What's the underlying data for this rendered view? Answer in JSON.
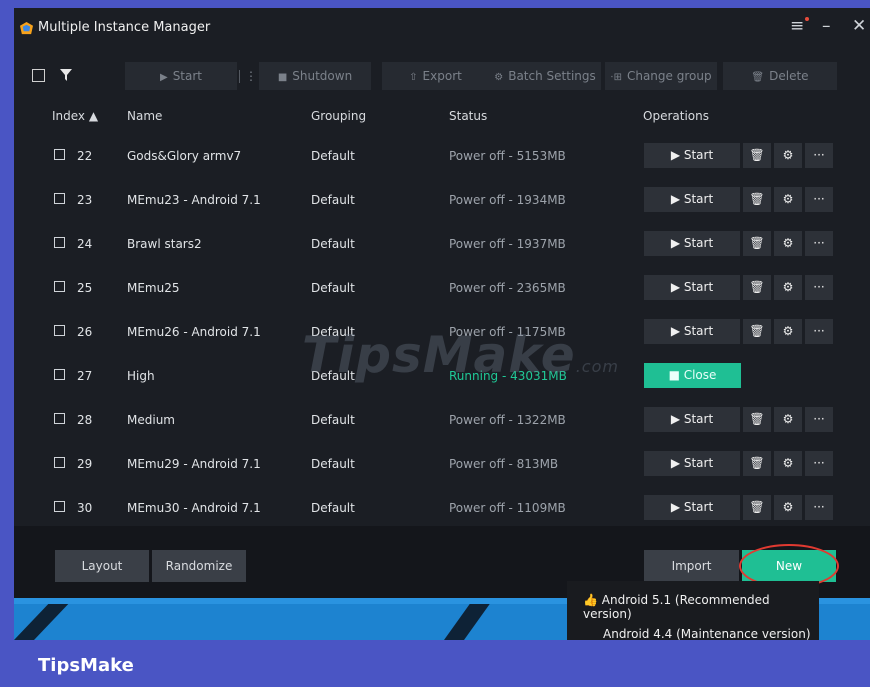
{
  "window": {
    "title": "Multiple Instance Manager",
    "menu_icon": "menu-icon",
    "minimize_icon": "minimize-icon",
    "close_icon": "close-icon"
  },
  "toolbar": {
    "start": "Start",
    "shutdown": "Shutdown",
    "export": "Export",
    "batch_settings": "Batch Settings",
    "change_group": "Change group",
    "delete": "Delete"
  },
  "table": {
    "headers": {
      "index": "Index ▲",
      "name": "Name",
      "grouping": "Grouping",
      "status": "Status",
      "operations": "Operations"
    },
    "rows": [
      {
        "index": "22",
        "name": "Gods&Glory armv7",
        "grouping": "Default",
        "status": "Power off - 5153MB",
        "action": "Start",
        "running": false
      },
      {
        "index": "23",
        "name": "MEmu23 - Android 7.1",
        "grouping": "Default",
        "status": "Power off - 1934MB",
        "action": "Start",
        "running": false
      },
      {
        "index": "24",
        "name": "Brawl stars2",
        "grouping": "Default",
        "status": "Power off - 1937MB",
        "action": "Start",
        "running": false
      },
      {
        "index": "25",
        "name": "MEmu25",
        "grouping": "Default",
        "status": "Power off - 2365MB",
        "action": "Start",
        "running": false
      },
      {
        "index": "26",
        "name": "MEmu26 - Android 7.1",
        "grouping": "Default",
        "status": "Power off - 1175MB",
        "action": "Start",
        "running": false
      },
      {
        "index": "27",
        "name": "High",
        "grouping": "Default",
        "status": "Running - 43031MB",
        "action": "Close",
        "running": true
      },
      {
        "index": "28",
        "name": "Medium",
        "grouping": "Default",
        "status": "Power off - 1322MB",
        "action": "Start",
        "running": false
      },
      {
        "index": "29",
        "name": "MEmu29 - Android 7.1",
        "grouping": "Default",
        "status": "Power off - 813MB",
        "action": "Start",
        "running": false
      },
      {
        "index": "30",
        "name": "MEmu30 - Android 7.1",
        "grouping": "Default",
        "status": "Power off - 1109MB",
        "action": "Start",
        "running": false
      }
    ]
  },
  "footer": {
    "layout": "Layout",
    "randomize": "Randomize",
    "import": "Import",
    "new": "New"
  },
  "new_menu": {
    "items": [
      "Android 5.1 (Recommended version)",
      "Android 4.4 (Maintenance version)"
    ]
  },
  "watermark": {
    "main": "TipsMake",
    "suffix": ".com"
  },
  "brand": "TipsMake",
  "colors": {
    "accent": "#1fbf94",
    "frame": "#4a55c4",
    "highlight_circle": "#e13a31"
  }
}
